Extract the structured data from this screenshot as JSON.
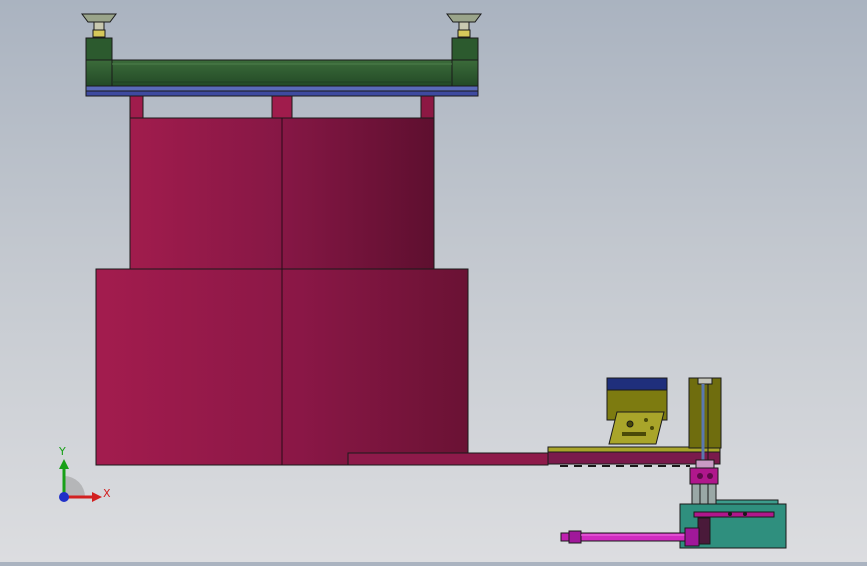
{
  "viewport": {
    "background_top": "#aab3c0",
    "background_bottom": "#dcdde0"
  },
  "model": {
    "colors": {
      "frame_green": "#2f5a30",
      "frame_green_light": "#3f7a40",
      "base_plate_blue": "#4b55a8",
      "column_red": "#a01c4c",
      "column_red_dark": "#6b1236",
      "olive": "#7d7b10",
      "olive_light": "#a9a52a",
      "navy": "#1e2f7a",
      "magenta": "#c020b0",
      "teal": "#2f8f7e",
      "edge": "#1a1a1a"
    }
  },
  "triad": {
    "x_label": "X",
    "y_label": "Y",
    "x_color": "#d22020",
    "y_color": "#18a018",
    "z_color": "#2030c8"
  }
}
